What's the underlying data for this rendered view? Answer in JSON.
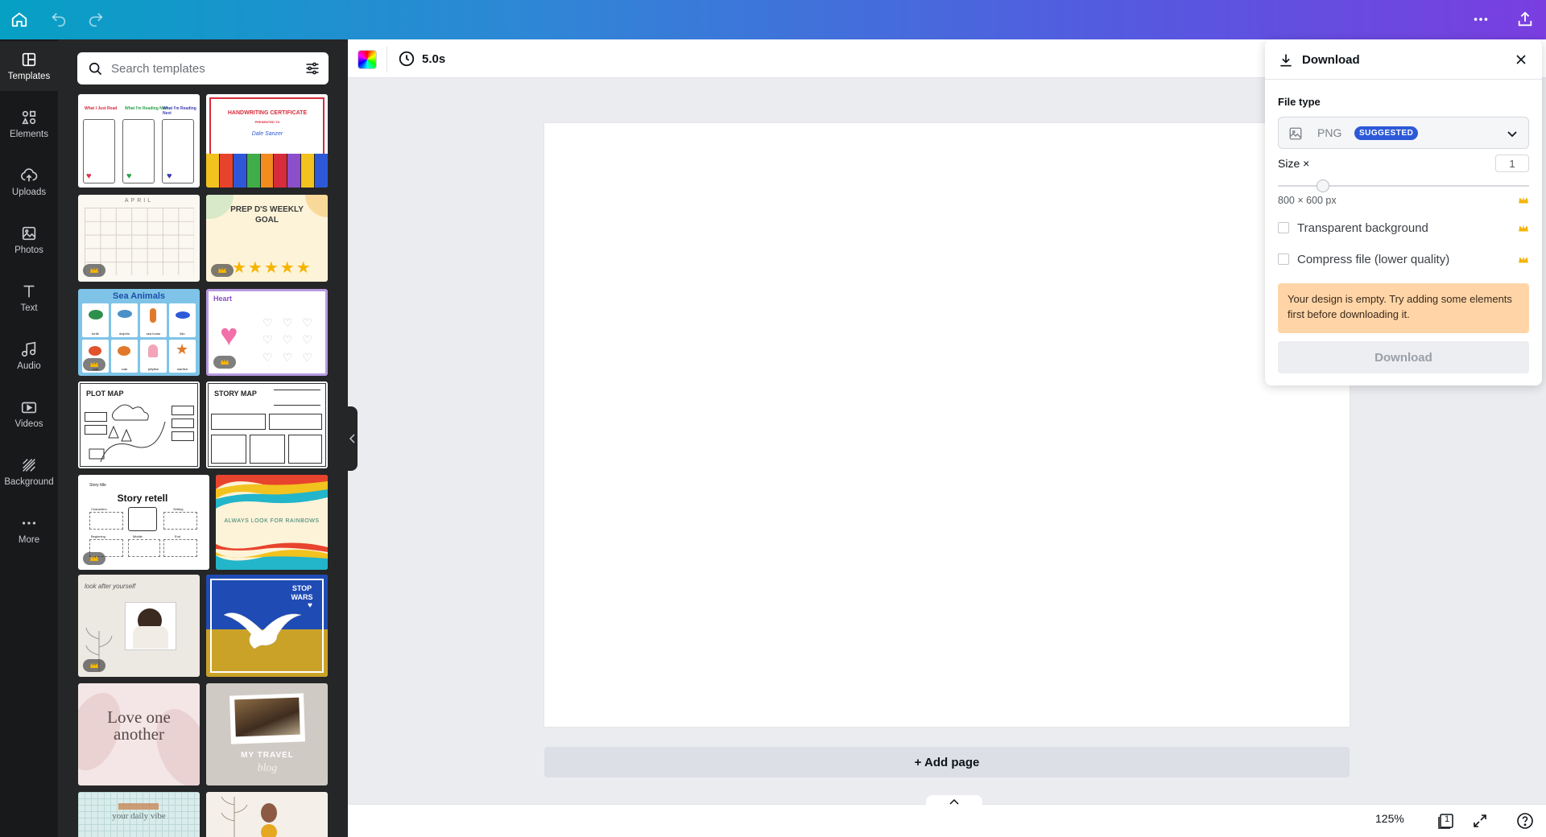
{
  "topbar": {
    "home_icon": "home-icon",
    "undo_icon": "undo-icon",
    "redo_icon": "redo-icon",
    "more_icon": "more-icon",
    "share_icon": "share-icon"
  },
  "rail": {
    "items": [
      {
        "label": "Templates",
        "icon": "templates-icon",
        "active": true
      },
      {
        "label": "Elements",
        "icon": "elements-icon"
      },
      {
        "label": "Uploads",
        "icon": "uploads-icon"
      },
      {
        "label": "Photos",
        "icon": "photos-icon"
      },
      {
        "label": "Text",
        "icon": "text-icon"
      },
      {
        "label": "Audio",
        "icon": "audio-icon"
      },
      {
        "label": "Videos",
        "icon": "videos-icon"
      },
      {
        "label": "Background",
        "icon": "background-icon"
      },
      {
        "label": "More",
        "icon": "more-icon"
      }
    ]
  },
  "search": {
    "placeholder": "Search templates"
  },
  "templates": {
    "t1": {
      "c1": "What I Just Read",
      "c2": "What I'm Reading Now",
      "c3": "What I'm Reading Next"
    },
    "t2": {
      "title": "HANDWRITING CERTIFICATE",
      "sub": "PRESENTED TO",
      "name": "Dale Sanzer"
    },
    "t3": {
      "title": "APRIL"
    },
    "t4": {
      "title": "PREP D'S WEEKLY GOAL"
    },
    "t5": {
      "title": "Sea Animals",
      "labels": [
        "turtle",
        "dolphin",
        "sea horse",
        "fish",
        "crab",
        "crab",
        "jellyfish",
        "starfish"
      ]
    },
    "t6": {
      "title": "Heart"
    },
    "t7": {
      "title": "PLOT MAP"
    },
    "t8": {
      "title": "STORY MAP"
    },
    "t9": {
      "title": "Story retell",
      "top": "Story title",
      "labels": [
        "Characters",
        "Setting",
        "Beginning",
        "Middle",
        "End"
      ]
    },
    "t10": {
      "title": "ALWAYS LOOK FOR RAINBOWS"
    },
    "t11": {
      "title": "look after yourself"
    },
    "t12": {
      "title": "STOP WARS"
    },
    "t13": {
      "title": "Love one another"
    },
    "t14": {
      "title": "MY TRAVEL",
      "script": "blog"
    },
    "t15": {
      "title": "your daily vibe"
    }
  },
  "toolbar": {
    "timer": "5.0s",
    "color_icon": "color-picker-icon",
    "timer_icon": "clock-icon"
  },
  "canvas": {
    "add_page": "+ Add page"
  },
  "footer": {
    "zoom": "125%",
    "page_count": "1"
  },
  "download": {
    "title": "Download",
    "file_type_label": "File type",
    "file_type": "PNG",
    "suggested": "SUGGESTED",
    "size_label": "Size ×",
    "size_value": "1",
    "size_px": "800 × 600 px",
    "transparent_bg": "Transparent background",
    "compress": "Compress file (lower quality)",
    "warning": "Your design is empty. Try adding some elements first before downloading it.",
    "button": "Download",
    "size_slider_fraction": 0.18
  },
  "colors": {
    "gradient_start": "#06a0c4",
    "gradient_end": "#7a3ee0",
    "rail_bg": "#18191b",
    "panel_bg": "#252627",
    "badge": "#2d59d8",
    "warning_bg": "#ffd5a8",
    "crown": "#f5b400"
  }
}
